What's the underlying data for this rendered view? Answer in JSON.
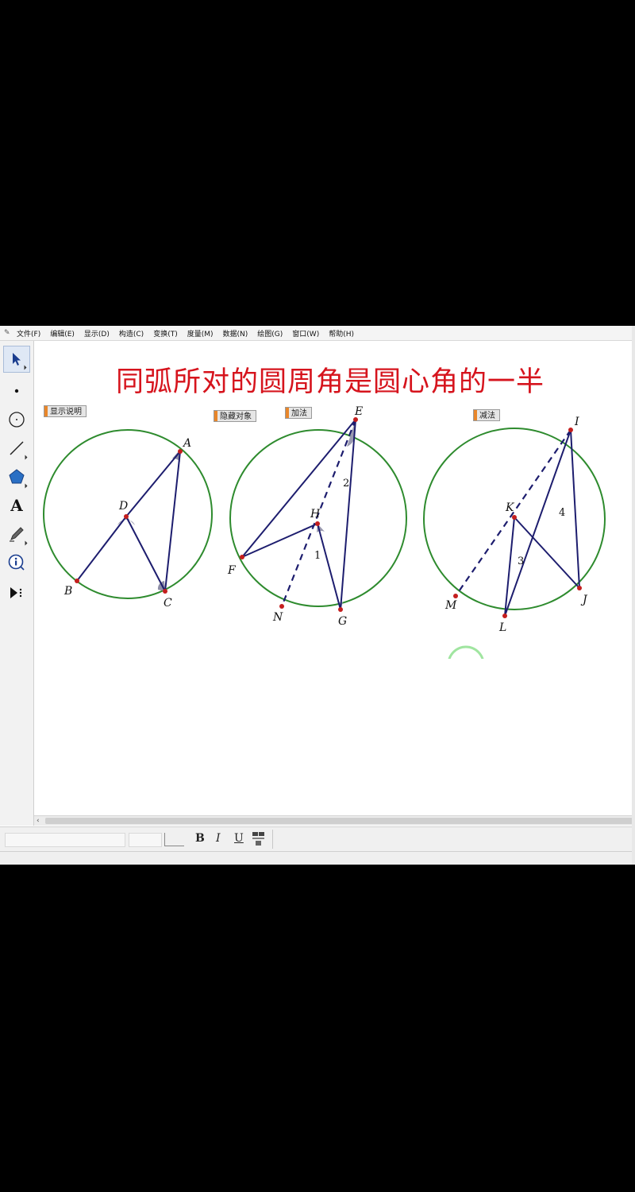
{
  "menu": [
    "文件(F)",
    "编辑(E)",
    "显示(D)",
    "构造(C)",
    "变换(T)",
    "度量(M)",
    "数据(N)",
    "绘图(G)",
    "窗口(W)",
    "帮助(H)"
  ],
  "title": "同弧所对的圆周角是圆心角的一半",
  "buttons": {
    "show_description": "显示说明",
    "hide_objects": "隐藏对象",
    "addition": "加法",
    "subtraction": "减法"
  },
  "figure1": {
    "labels": {
      "A": "A",
      "B": "B",
      "C": "C",
      "D": "D"
    }
  },
  "figure2": {
    "labels": {
      "E": "E",
      "F": "F",
      "G": "G",
      "H": "H",
      "N": "N"
    },
    "angle_labels": {
      "one": "1",
      "two": "2"
    }
  },
  "figure3": {
    "labels": {
      "I": "I",
      "J": "J",
      "K": "K",
      "L": "L",
      "M": "M"
    },
    "angle_labels": {
      "three": "3",
      "four": "4"
    }
  },
  "textbar": {
    "bold": "B",
    "italic": "I",
    "underline": "U"
  },
  "colors": {
    "title": "#d6141d",
    "circle": "#2e8b2e",
    "segment": "#1d1d6e",
    "point": "#c41e1e"
  }
}
